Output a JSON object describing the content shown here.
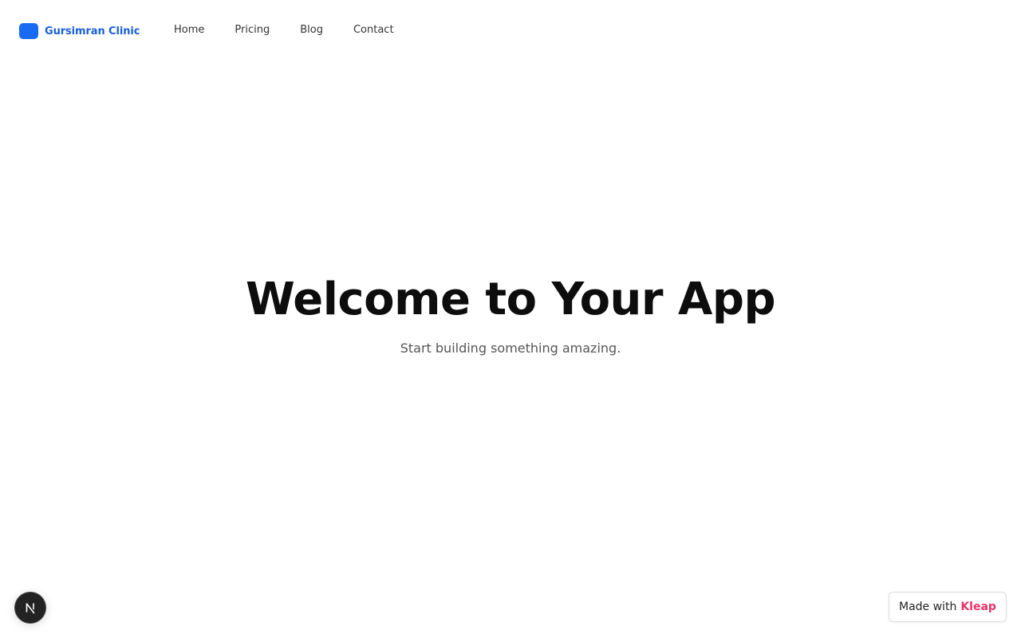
{
  "header": {
    "brand_name": "Gursimran Clinic",
    "brand_color": "#1a6bf3",
    "nav": [
      {
        "label": "Home"
      },
      {
        "label": "Pricing"
      },
      {
        "label": "Blog"
      },
      {
        "label": "Contact"
      }
    ]
  },
  "hero": {
    "title": "Welcome to Your App",
    "subtitle": "Start building something amazing."
  },
  "badges": {
    "dev_indicator_icon": "next-logo-icon",
    "made_with_text": "Made with",
    "made_with_brand": "Kleap",
    "made_with_brand_color": "#e8336b"
  }
}
